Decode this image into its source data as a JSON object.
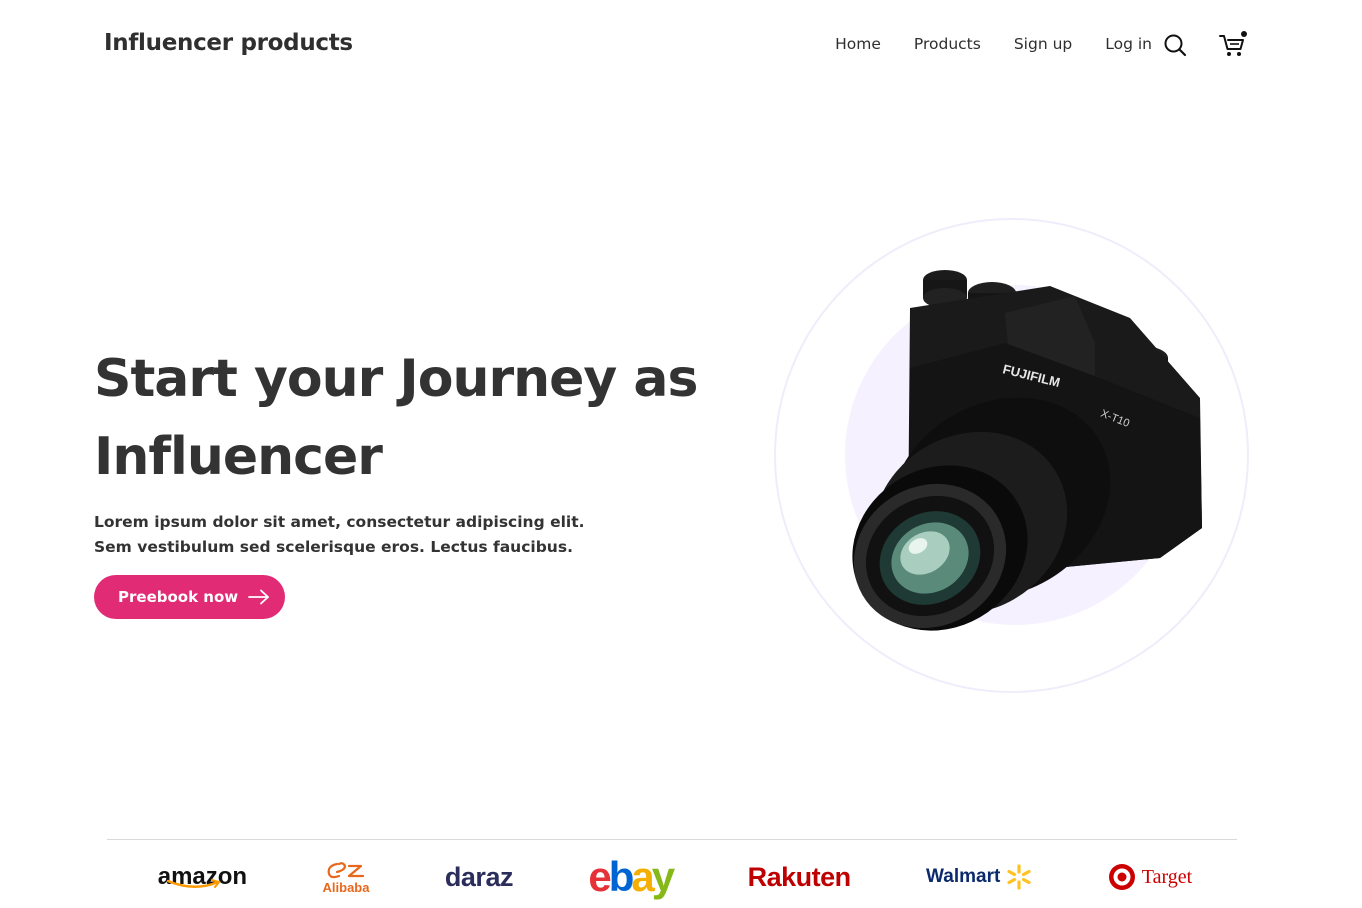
{
  "header": {
    "brand": "Influencer products",
    "nav": [
      "Home",
      "Products",
      "Sign up",
      "Log in"
    ]
  },
  "hero": {
    "title_line1": "Start your Journey as",
    "title_line2": "Influencer",
    "subtitle": "Lorem ipsum dolor sit amet, consectetur adipiscing elit. Sem vestibulum sed scelerisque eros. Lectus faucibus.",
    "cta_label": "Preebook now",
    "camera_brand_text": "FUJIFILM",
    "camera_model_text": "X-T10"
  },
  "partners": {
    "amazon": "amazon",
    "alibaba": "Alibaba",
    "daraz": "daraz",
    "ebay": [
      "e",
      "b",
      "a",
      "y"
    ],
    "rakuten": "Rakuten",
    "walmart": "Walmart",
    "target": "Target"
  },
  "colors": {
    "accent": "#e12b75",
    "text": "#2f2f2f",
    "circle_fill": "#f6f1fe",
    "ebay": [
      "#e53238",
      "#0064d2",
      "#f5af02",
      "#86b817"
    ]
  }
}
